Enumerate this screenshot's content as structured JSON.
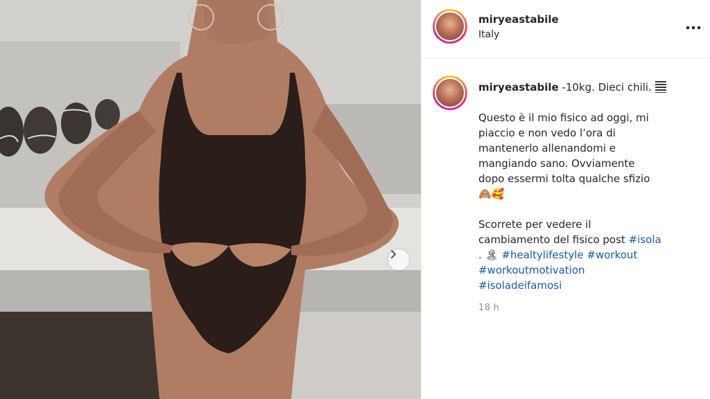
{
  "post": {
    "username": "miryeastabile",
    "location": "Italy",
    "caption": {
      "intro": "-10kg. Dieci chili.",
      "paragraph1_lines": [
        "Questo è il mio fisico ad oggi, mi",
        "piaccio e non vedo l’ora di",
        "mantenerlo allenandomi e",
        "mangiando sano. Ovviamente",
        "dopo essermi tolta qualche sfizio"
      ],
      "paragraph1_emoji": "🙈🥰",
      "paragraph2_line1": "Scorrete per vedere il",
      "paragraph2_line2": "cambiamento del fisico post",
      "hashtags": {
        "isola": "#isola",
        "healtylifestyle": "#healtylifestyle",
        "workout": "#workout",
        "workoutmotivation": "#workoutmotivation",
        "isoladeifamosi": "#isoladeifamosi"
      },
      "dot": ".",
      "island_emoji": "🏝"
    },
    "timestamp": "18 h"
  },
  "icons": {
    "more": "more-options-icon",
    "next": "chevron-right-icon"
  },
  "colors": {
    "hashtag": "#1a5aa0",
    "username": "#262626",
    "timestamp": "#8e8e8e"
  }
}
